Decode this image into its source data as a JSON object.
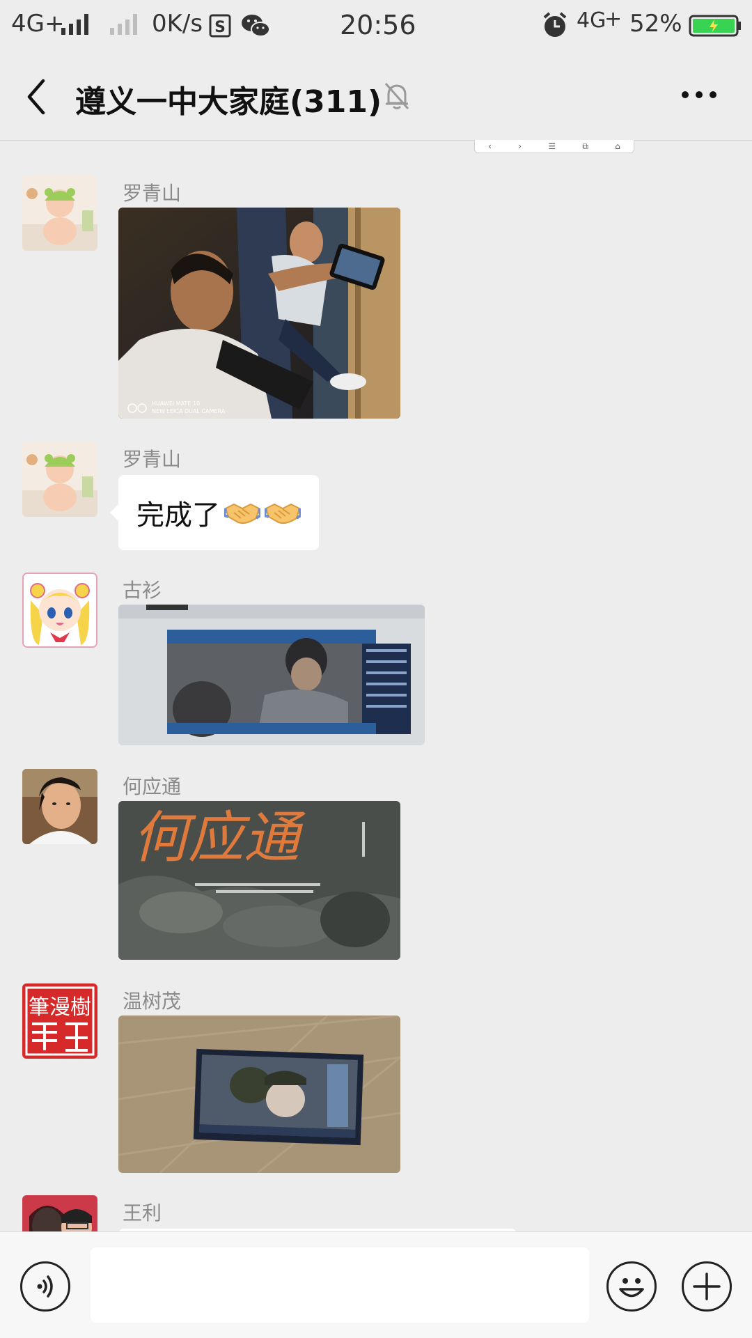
{
  "status_bar": {
    "network_left": "4G+",
    "speed": "0K/s",
    "time": "20:56",
    "network_right": "4G",
    "network_right_plus": "+",
    "battery": "52%",
    "colors": {
      "battery_fill": "#39d353",
      "text": "#333333"
    }
  },
  "header": {
    "title": "遵义一中大家庭(311)",
    "back_icon": "chevron-left-icon",
    "mute_icon": "bell-off-icon",
    "more_icon": "more-dots-icon"
  },
  "mini_bar": {
    "icons": [
      "‹",
      "›",
      "☰",
      "⧉",
      "⌂"
    ]
  },
  "messages": [
    {
      "sender": "罗青山",
      "type": "image",
      "watermark_line1": "HUAWEI MATE 10",
      "watermark_line2": "NEW LEICA DUAL CAMERA"
    },
    {
      "sender": "罗青山",
      "type": "text",
      "text": "完成了",
      "emoji": [
        "handshake-icon",
        "handshake-icon"
      ]
    },
    {
      "sender": "古衫",
      "type": "image"
    },
    {
      "sender": "何应通",
      "type": "image",
      "image_text": "何应通"
    },
    {
      "sender": "温树茂",
      "type": "image",
      "avatar_text": "筆漫樹"
    },
    {
      "sender": "王利",
      "type": "text",
      "text": ""
    }
  ],
  "input_bar": {
    "voice_icon": "voice-icon",
    "emoji_icon": "emoji-icon",
    "plus_icon": "plus-icon",
    "placeholder": ""
  },
  "colors": {
    "background": "#ededed",
    "bubble": "#ffffff",
    "sender_name": "#8a8a8a"
  }
}
